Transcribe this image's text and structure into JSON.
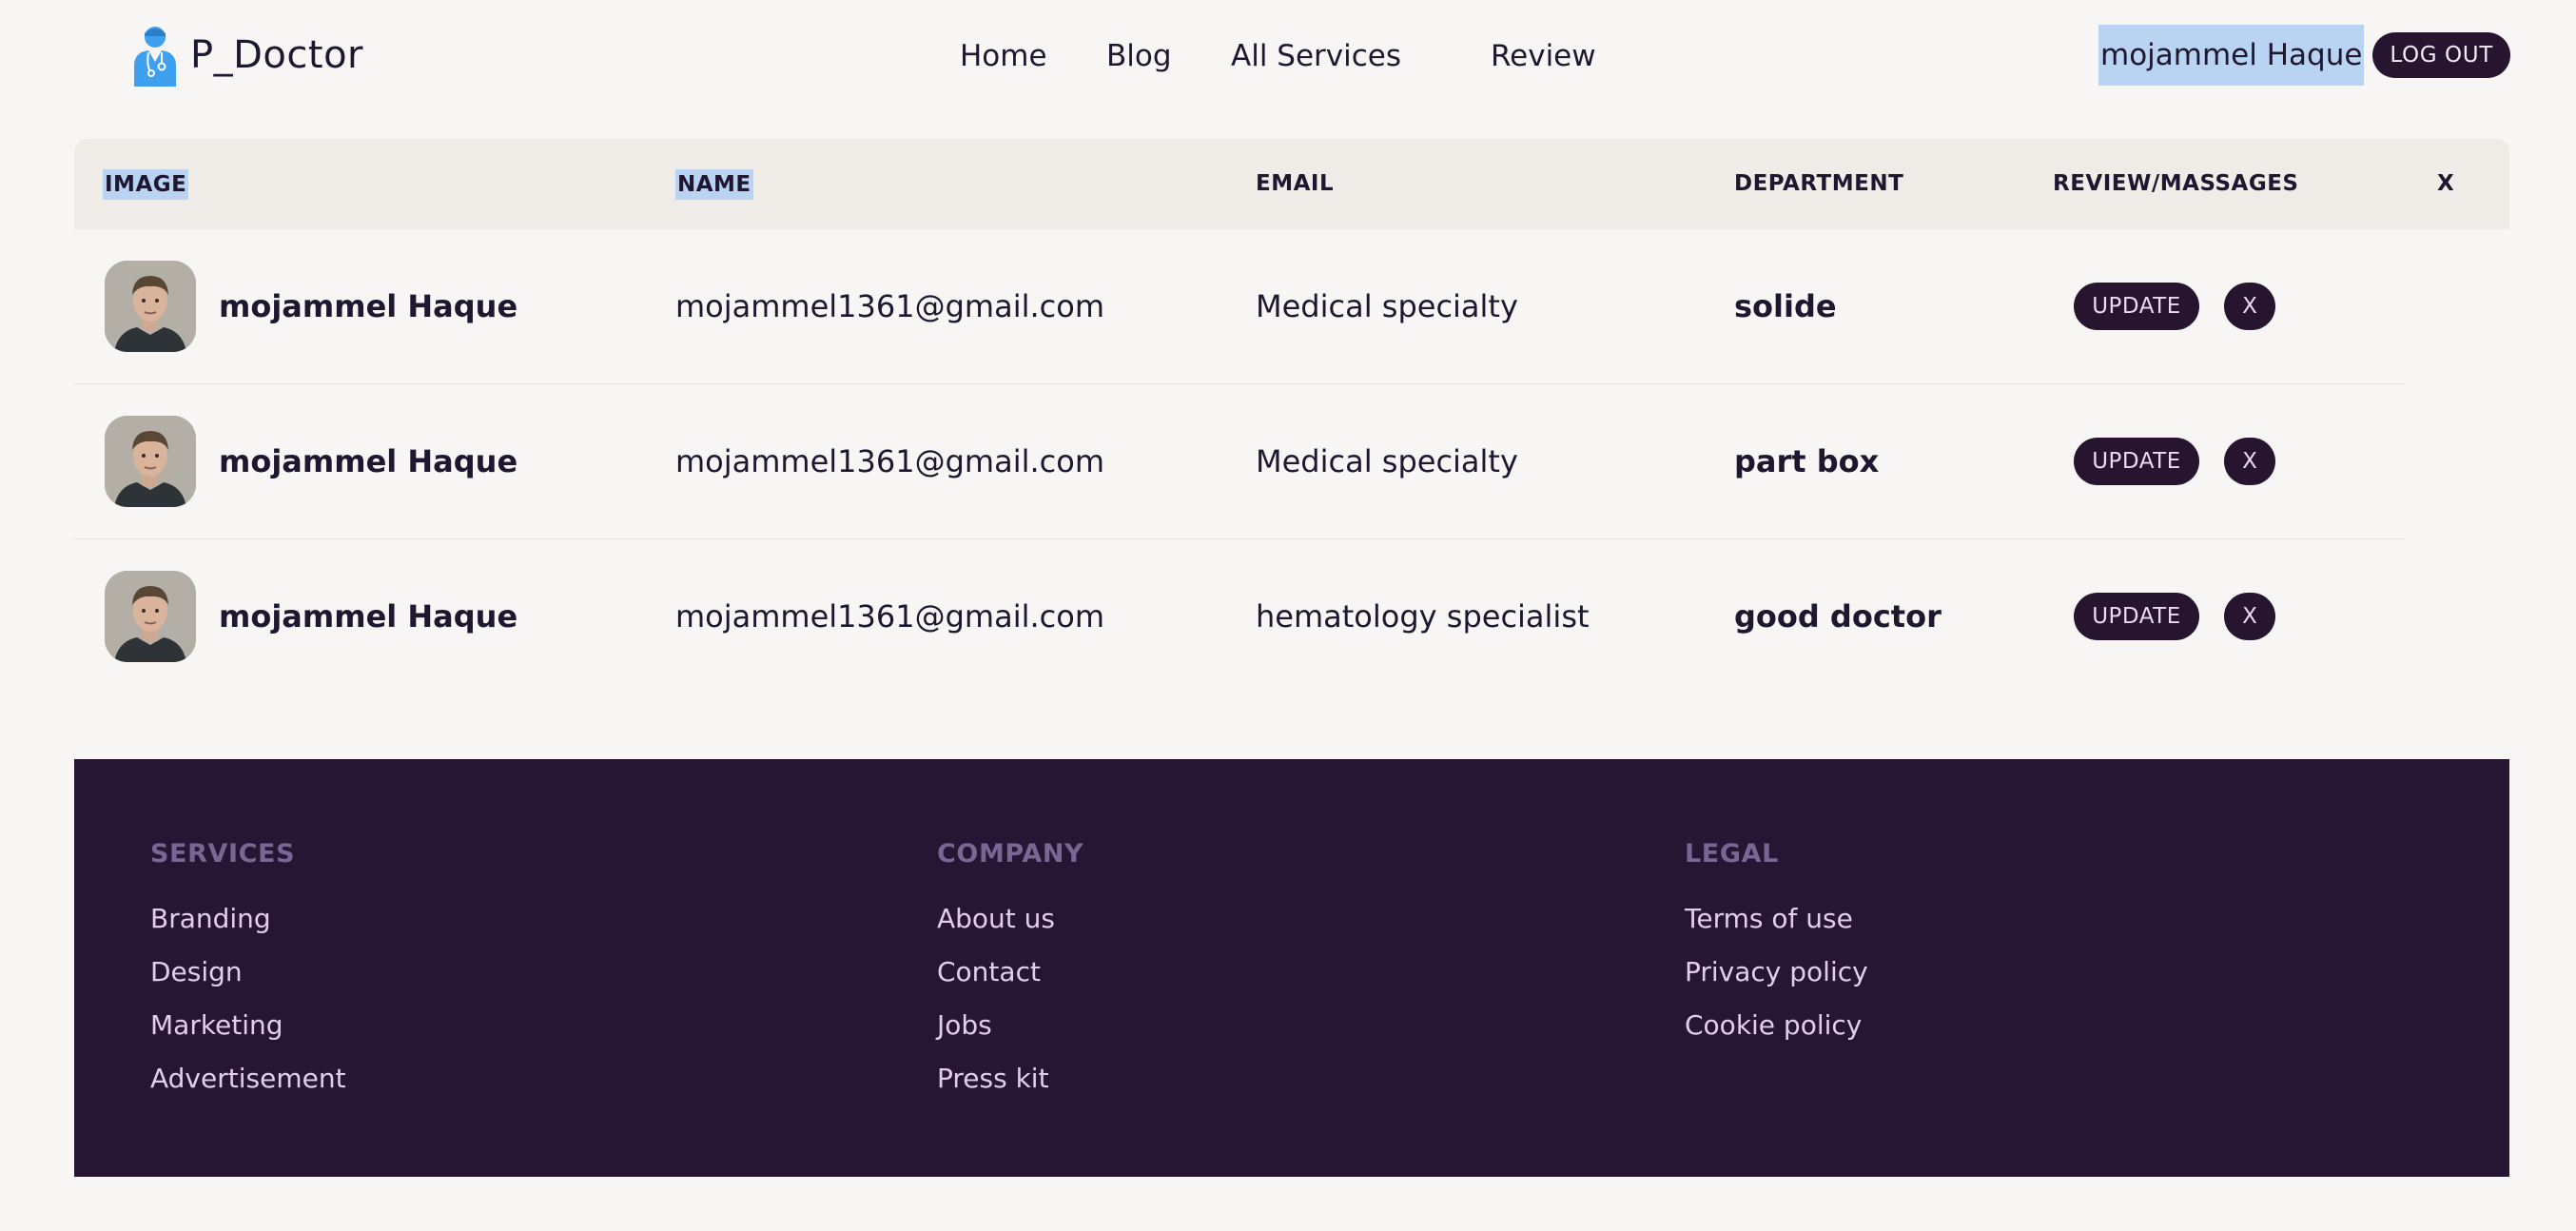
{
  "brand": {
    "name": "P_Doctor",
    "icon": "doctor-icon",
    "icon_color": "#3fa0ef"
  },
  "nav": {
    "home": "Home",
    "blog": "Blog",
    "services": "All Services",
    "review": "Review"
  },
  "user": {
    "name": "mojammel Haque",
    "logout_label": "LOG OUT"
  },
  "table": {
    "headers": {
      "image": "IMAGE",
      "name": "NAME",
      "email": "EMAIL",
      "department": "DEPARTMENT",
      "review": "REVIEW/MASSAGES",
      "x": "X"
    },
    "rows": [
      {
        "name": "mojammel Haque",
        "email": "mojammel1361@gmail.com",
        "department": "Medical specialty",
        "review": "solide",
        "update_label": "UPDATE",
        "delete_label": "X"
      },
      {
        "name": "mojammel Haque",
        "email": "mojammel1361@gmail.com",
        "department": "Medical specialty",
        "review": "part box",
        "update_label": "UPDATE",
        "delete_label": "X"
      },
      {
        "name": "mojammel Haque",
        "email": "mojammel1361@gmail.com",
        "department": "hematology specialist",
        "review": "good doctor",
        "update_label": "UPDATE",
        "delete_label": "X"
      }
    ]
  },
  "footer": {
    "services": {
      "title": "SERVICES",
      "links": [
        "Branding",
        "Design",
        "Marketing",
        "Advertisement"
      ]
    },
    "company": {
      "title": "COMPANY",
      "links": [
        "About us",
        "Contact",
        "Jobs",
        "Press kit"
      ]
    },
    "legal": {
      "title": "LEGAL",
      "links": [
        "Terms of use",
        "Privacy policy",
        "Cookie policy"
      ]
    }
  },
  "colors": {
    "background": "#f7f6f5",
    "dark": "#27142f",
    "footer_bg": "#261533",
    "selection": "#b9d4f3"
  }
}
